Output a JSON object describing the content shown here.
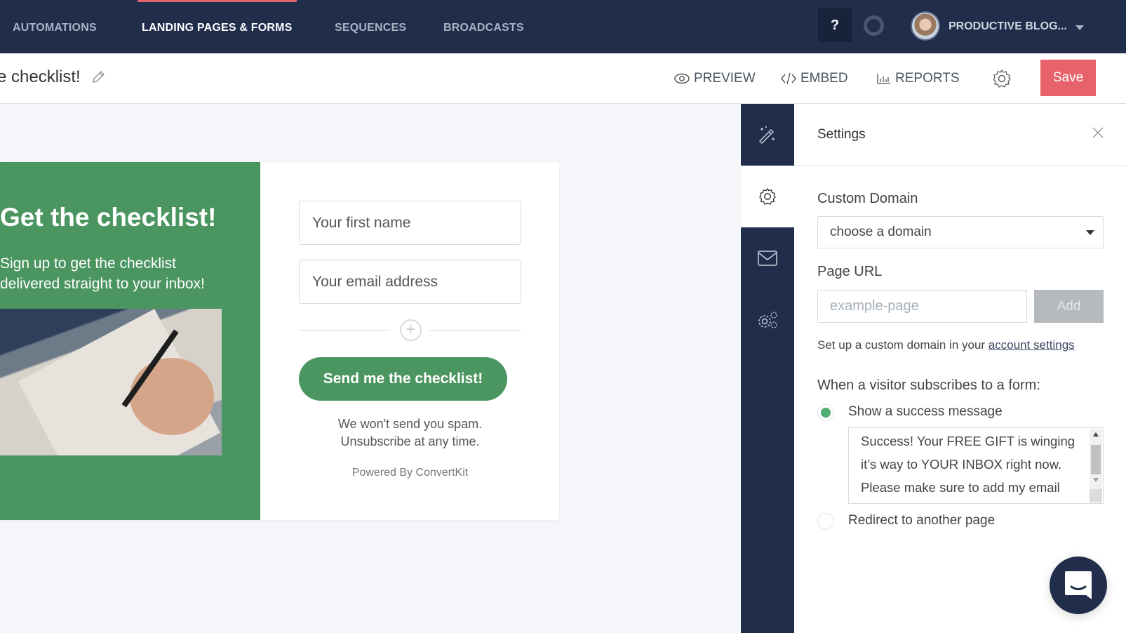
{
  "topnav": {
    "items": [
      {
        "label": "AUTOMATIONS",
        "active": false
      },
      {
        "label": "LANDING PAGES & FORMS",
        "active": true
      },
      {
        "label": "SEQUENCES",
        "active": false
      },
      {
        "label": "BROADCASTS",
        "active": false
      }
    ],
    "help_label": "?",
    "account_name": "PRODUCTIVE BLOG...",
    "icons": {
      "help": "question-icon",
      "status": "ring-icon",
      "avatar": "user-avatar",
      "caret": "caret-down-icon"
    }
  },
  "toolbar": {
    "page_title": "e checklist!",
    "preview_label": "PREVIEW",
    "embed_label": "EMBED",
    "reports_label": "REPORTS",
    "save_label": "Save",
    "icons": {
      "edit": "pencil-icon",
      "preview": "eye-icon",
      "embed": "code-icon",
      "reports": "bar-chart-icon",
      "settings": "gear-icon"
    }
  },
  "landing_page": {
    "headline": "Get the checklist!",
    "subtext": "Sign up to get the checklist delivered straight to your inbox!",
    "first_name_placeholder": "Your first name",
    "email_placeholder": "Your email address",
    "add_field_symbol": "+",
    "button_label": "Send me the checklist!",
    "spam_line1": "We won't send you spam.",
    "spam_line2": "Unsubscribe at any time.",
    "powered_by": "Powered By ConvertKit",
    "colors": {
      "brand_green": "#4a9560"
    }
  },
  "rail": {
    "items": [
      {
        "icon": "magic-wand-icon",
        "active": false
      },
      {
        "icon": "gear-icon",
        "active": true
      },
      {
        "icon": "envelope-icon",
        "active": false
      },
      {
        "icon": "gears-icon",
        "active": false
      }
    ]
  },
  "settings_panel": {
    "title": "Settings",
    "custom_domain_label": "Custom Domain",
    "domain_select_value": "choose a domain",
    "page_url_label": "Page URL",
    "page_url_placeholder": "example-page",
    "add_label": "Add",
    "help_prefix": "Set up a custom domain in your ",
    "help_link": "account settings",
    "subscribe_label": "When a visitor subscribes to a form:",
    "options": [
      {
        "label": "Show a success message",
        "selected": true
      },
      {
        "label": "Redirect to another page",
        "selected": false
      }
    ],
    "success_message": "Success! Your FREE GIFT is winging it’s way to YOUR INBOX right now. Please make sure to add my email"
  },
  "colors": {
    "nav_bg": "#202d4b",
    "accent_red": "#e8626b",
    "radio_green": "#4dad73"
  }
}
